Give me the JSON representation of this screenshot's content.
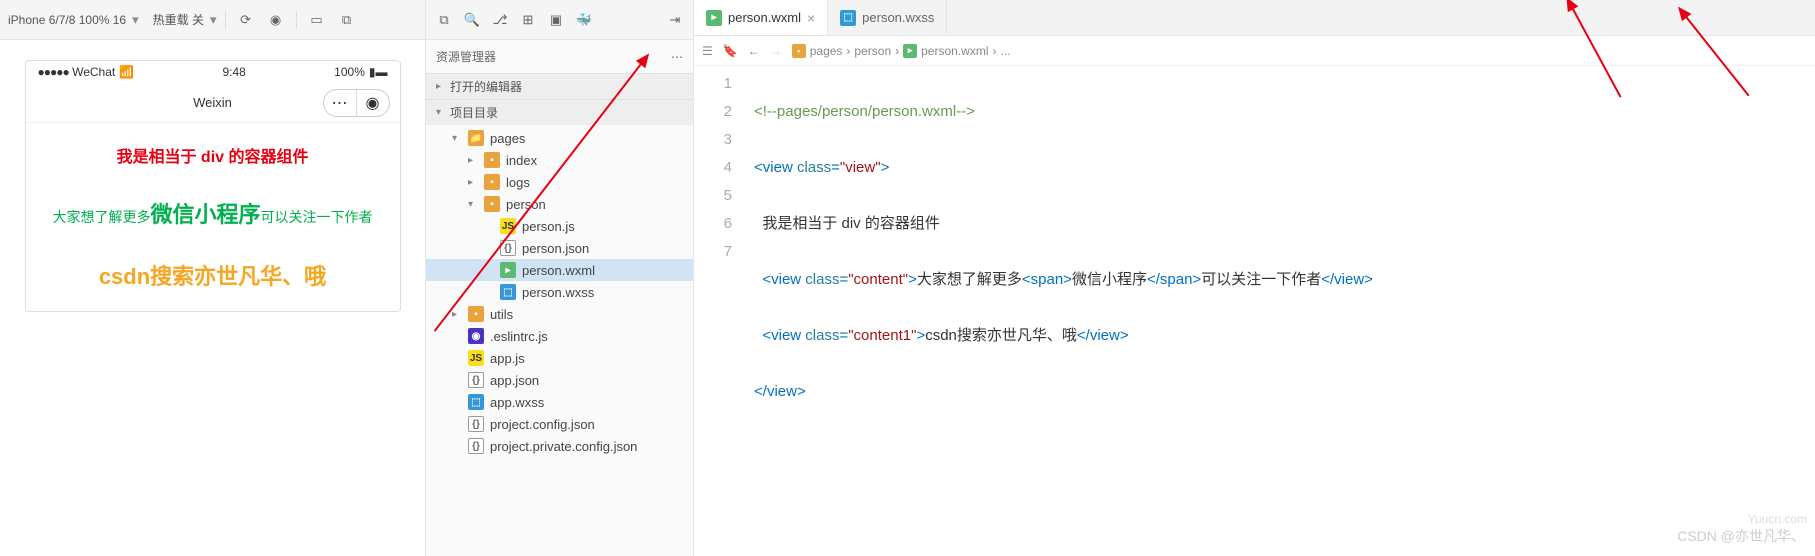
{
  "toolbar": {
    "device": "iPhone 6/7/8 100% 16",
    "hotreload": "热重载 关"
  },
  "sim": {
    "carrier": "WeChat",
    "time": "9:48",
    "battery": "100%",
    "title": "Weixin",
    "line1": "我是相当于 div 的容器组件",
    "line2a": "大家想了解更多",
    "line2b": "微信小程序",
    "line2c": "可以关注一下作者",
    "line3": "csdn搜索亦世凡华、哦"
  },
  "explorer": {
    "title": "资源管理器",
    "openEditors": "打开的编辑器",
    "projectDir": "项目目录"
  },
  "tree": {
    "pages": "pages",
    "index": "index",
    "logs": "logs",
    "person": "person",
    "personjs": "person.js",
    "personjson": "person.json",
    "personwxml": "person.wxml",
    "personwxss": "person.wxss",
    "utils": "utils",
    "eslint": ".eslintrc.js",
    "appjs": "app.js",
    "appjson": "app.json",
    "appwxss": "app.wxss",
    "projconfig": "project.config.json",
    "projprivate": "project.private.config.json"
  },
  "tabs": {
    "t1": "person.wxml",
    "t2": "person.wxss"
  },
  "crumbs": {
    "c1": "pages",
    "c2": "person",
    "c3": "person.wxml",
    "c4": "..."
  },
  "code": {
    "l1a": "<!--",
    "l1b": "pages/person/person.wxml",
    "l1c": "-->",
    "l2a": "<",
    "l2b": "view",
    "l2c": " class",
    "l2d": "=",
    "l2e": "\"view\"",
    "l2f": ">",
    "l3": "我是相当于 div 的容器组件",
    "l4a": "<",
    "l4b": "view",
    "l4c": " class",
    "l4d": "=",
    "l4e": "\"content\"",
    "l4f": ">",
    "l4g": "大家想了解更多",
    "l4h": "<",
    "l4i": "span",
    "l4j": ">",
    "l4k": "微信小程序",
    "l4l": "</",
    "l4m": "span",
    "l4n": ">",
    "l4o": "可以关注一下作者",
    "l4p": "</",
    "l4q": "view",
    "l4r": ">",
    "l5a": "<",
    "l5b": "view",
    "l5c": " class",
    "l5d": "=",
    "l5e": "\"content1\"",
    "l5f": ">",
    "l5g": "csdn搜索亦世凡华、哦",
    "l5h": "</",
    "l5i": "view",
    "l5j": ">",
    "l6a": "</",
    "l6b": "view",
    "l6c": ">"
  },
  "lines": {
    "n1": "1",
    "n2": "2",
    "n3": "3",
    "n4": "4",
    "n5": "5",
    "n6": "6",
    "n7": "7"
  },
  "watermark": {
    "w1": "Yuucn.com",
    "w2": "CSDN @亦世凡华、"
  }
}
